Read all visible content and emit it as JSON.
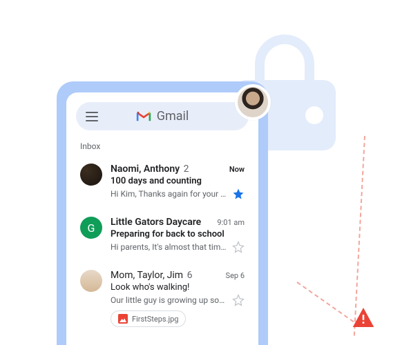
{
  "app": {
    "name": "Gmail"
  },
  "inbox_label": "Inbox",
  "emails": [
    {
      "senders": "Naomi, Anthony",
      "count": "2",
      "time": "Now",
      "subject": "100 days and counting",
      "snippet": "Hi Kim, Thanks again for your sweet…",
      "unread": true,
      "starred": true,
      "avatar_letter": ""
    },
    {
      "senders": "Little Gators Daycare",
      "count": "",
      "time": "9:01 am",
      "subject": "Preparing for back to school",
      "snippet": "Hi parents, It's almost that time…",
      "unread": true,
      "starred": false,
      "avatar_letter": "G"
    },
    {
      "senders": "Mom, Taylor, Jim",
      "count": "6",
      "time": "Sep 6",
      "subject": "Look who's walking!",
      "snippet": "Our little guy is growing up soo fast",
      "unread": false,
      "starred": false,
      "attachment": "FirstSteps.jpg"
    }
  ]
}
